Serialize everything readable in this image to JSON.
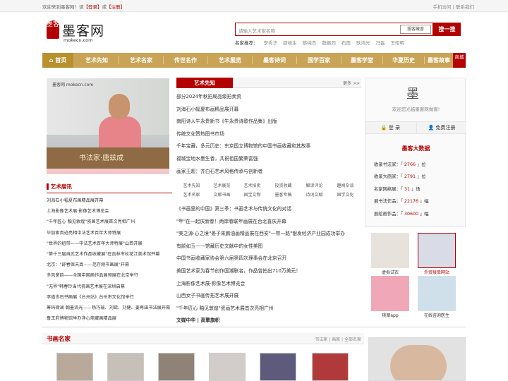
{
  "topbar": {
    "welcome": "欢迎来到墨客网！请",
    "login": "【登录】",
    "or": "或",
    "register": "【注册】",
    "mobile": "手机访问",
    "sep": "|",
    "contact": "联系我们"
  },
  "logo": {
    "seal": "墨客",
    "name": "墨客网",
    "url": "mokecn.com"
  },
  "search": {
    "placeholder": "请输入艺术家名称",
    "seal_text": "拔客藏書",
    "button": "搜一搜",
    "hot_label": "名家推荐：",
    "hot_names": [
      "李秀华",
      "邵维生",
      "蔡纯杰",
      "魏振同",
      "石雨",
      "耿鸿光",
      "冯磊",
      "王昭明"
    ]
  },
  "nav": {
    "home": "首页",
    "items": [
      "艺术先知",
      "艺术名家",
      "传世名作",
      "艺术展览",
      "墨客诗词",
      "国学百家",
      "墨客学堂",
      "华夏历史",
      "墨客故事"
    ],
    "shop": "商城"
  },
  "feature": {
    "caption": "书法家·唐兹成",
    "brand": "墨客网 mokecn.com"
  },
  "exhibit": {
    "title": "艺术展讯",
    "items": [
      "刘海石小幅夏布画精品展开幕",
      "上海影像艺术展·影像艺术博览会",
      "\"千年匠心 釉见敦煌\"瓷画艺术展首次亮相广州",
      "毕加索真迹亮相中法艺术百年大师特展",
      "\"世界的纽带——中法艺术百年大师特展\"山西开展",
      "\"第十三届自武艺术作品收藏展\"在吉林市松花江美术馆开幕",
      "北京：\"舒春保天真——范存刚书画展\"开幕",
      "多风意韵——全国中国画作品展预展在北京举行",
      "\"无界\"韩春玲当代瓷画艺术展在深圳启幕",
      "李道世石书画展《台州站》台州市文化馆举行",
      "筹码微澜 翰墨流光——杨巧瑞、刘娣、刘健、姜再田书法展开幕",
      "鲁王府博物馆举办净心斋藏画精品展"
    ]
  },
  "news": {
    "tab": "艺术先知",
    "more": "更多 >>",
    "items": [
      "部分2024年秋拍局品级拍卖资",
      "刘海石小幅夏布画精品展开幕",
      "南阳诗人牛永贵新书《牛永贵诗歌作品集》出版",
      "传统文化赞热图书市场",
      "千年宝藏，多元历史：东京国立博物馆的中国书画收藏和其故事",
      "福城宝地水墨生香，共祝祖国繁荣富强",
      "画家王超：齐白石艺术风格传承与创新者"
    ]
  },
  "categories": [
    "艺术先知",
    "艺术展览",
    "艺术拍卖",
    "投资收藏",
    "解读评论",
    "趣闻杂谈",
    "艺术名家",
    "文献书画",
    "国宝文物",
    "墨客专稿",
    "诗词文赋",
    "国学文化"
  ],
  "news2": [
    "《书画里的中国》第三季：书画艺术与传统文化的对话",
    "\"年\"在一起庆新春！两岸春联年画展在台北喜庆开幕",
    "\"美之源·心之境\"晏子来鹏油画精品展在西安\"一带一路\"银发经济产业园成功举办",
    "有颜如玉——馆藏历史文献中的女性美图",
    "中国书画收藏家协会第六届第四次理事会在北京召开",
    "美国艺术家为春节创作国潮联名，作品曾拍出710万美元！",
    "上海影像艺术展·影像艺术博览会",
    "山西女子书画传拓艺术展开展",
    "\"千年匠心 釉见敦煌\"瓷画艺术展首次亮相广州",
    "文媒中华 | 高擎旗帜"
  ],
  "member": {
    "glyph": "墨",
    "welcome": "欢迎您光临墨客网做客!",
    "login": "登 录",
    "register": "免费注册"
  },
  "bigdata": {
    "title": "墨客大数据",
    "stats": [
      {
        "label": "收录书法家：",
        "value": "2766",
        "unit": "位"
      },
      {
        "label": "收录大画家：",
        "value": "2791",
        "unit": "位"
      },
      {
        "label": "名家网络展：",
        "value": "31",
        "unit": "场"
      },
      {
        "label": "展书法作品：",
        "value": "22176",
        "unit": "幅"
      },
      {
        "label": "展绘画作品：",
        "value": "30600",
        "unit": "幅"
      }
    ]
  },
  "thumbs": [
    {
      "label": "虚拟试衣",
      "color": "#e8e2dc"
    },
    {
      "label": "外贸接单网站",
      "color": "#d9dbe6"
    },
    {
      "label": "桃案app",
      "color": "#f0a8b8"
    },
    {
      "label": "在线咨询医生",
      "color": "#cfe0ea"
    }
  ],
  "famous": {
    "title": "书画名家",
    "links": [
      "书法家",
      "画家",
      "全部名家"
    ],
    "seps": [
      "|",
      "|"
    ]
  }
}
